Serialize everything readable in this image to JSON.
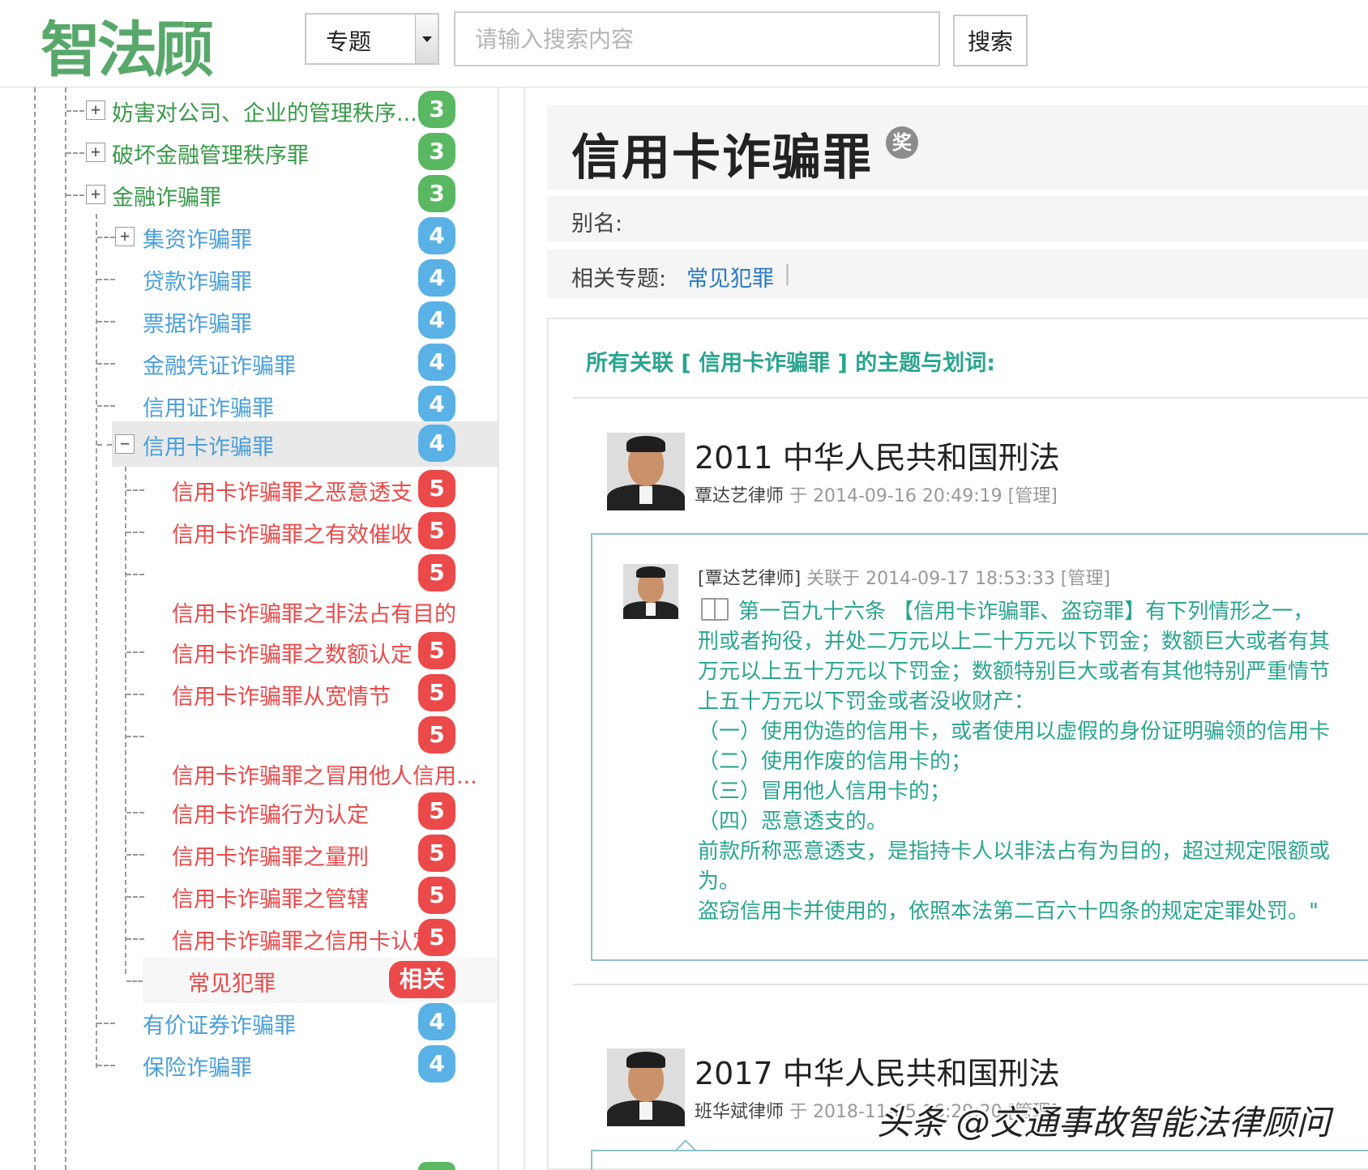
{
  "header": {
    "logo_text": "智法顾",
    "select_value": "专题",
    "search_placeholder": "请输入搜索内容",
    "search_button": "搜索"
  },
  "sidebar": {
    "items": [
      {
        "label": "妨害对公司、企业的管理秩序...",
        "badge": "3",
        "color": "green",
        "toggle": "+"
      },
      {
        "label": "破坏金融管理秩序罪",
        "badge": "3",
        "color": "green",
        "toggle": "+"
      },
      {
        "label": "金融诈骗罪",
        "badge": "3",
        "color": "green",
        "toggle": "+"
      },
      {
        "label": "集资诈骗罪",
        "badge": "4",
        "color": "blue",
        "toggle": "+"
      },
      {
        "label": "贷款诈骗罪",
        "badge": "4",
        "color": "blue"
      },
      {
        "label": "票据诈骗罪",
        "badge": "4",
        "color": "blue"
      },
      {
        "label": "金融凭证诈骗罪",
        "badge": "4",
        "color": "blue"
      },
      {
        "label": "信用证诈骗罪",
        "badge": "4",
        "color": "blue"
      },
      {
        "label": "信用卡诈骗罪",
        "badge": "4",
        "color": "blue",
        "toggle": "−"
      },
      {
        "label": "信用卡诈骗罪之恶意透支",
        "badge": "5",
        "color": "red"
      },
      {
        "label": "信用卡诈骗罪之有效催收",
        "badge": "5",
        "color": "red"
      },
      {
        "label": "",
        "badge": "5",
        "color": "red"
      },
      {
        "label": "信用卡诈骗罪之非法占有目的",
        "badge": "",
        "color": "red"
      },
      {
        "label": "信用卡诈骗罪之数额认定",
        "badge": "5",
        "color": "red"
      },
      {
        "label": "信用卡诈骗罪从宽情节",
        "badge": "5",
        "color": "red"
      },
      {
        "label": "",
        "badge": "5",
        "color": "red"
      },
      {
        "label": "信用卡诈骗罪之冒用他人信用...",
        "badge": "",
        "color": "red"
      },
      {
        "label": "信用卡诈骗行为认定",
        "badge": "5",
        "color": "red"
      },
      {
        "label": "信用卡诈骗罪之量刑",
        "badge": "5",
        "color": "red"
      },
      {
        "label": "信用卡诈骗罪之管辖",
        "badge": "5",
        "color": "red"
      },
      {
        "label": "信用卡诈骗罪之信用卡认定",
        "badge": "5",
        "color": "red"
      },
      {
        "label": "常见犯罪",
        "badge": "相关",
        "color": "red"
      },
      {
        "label": "有价证券诈骗罪",
        "badge": "4",
        "color": "blue"
      },
      {
        "label": "保险诈骗罪",
        "badge": "4",
        "color": "blue"
      }
    ]
  },
  "main": {
    "title": "信用卡诈骗罪",
    "award_icon_text": "奖",
    "alias_label": "别名:",
    "topic_label": "相关专题:",
    "topic_link": "常见犯罪",
    "topic_sep": "|",
    "section_heading": "所有关联 [ 信用卡诈骗罪 ] 的主题与划词:",
    "posts": [
      {
        "title": "2011 中华人民共和国刑法",
        "author": "覃达艺律师",
        "meta": " 于 2014-09-16 20:49:19    [管理]"
      },
      {
        "title": "2017 中华人民共和国刑法",
        "author": "班华斌律师",
        "meta": " 于 2018-11-05 16:29:20    [管理]"
      }
    ],
    "comment": {
      "author": "[覃达艺律师]",
      "meta": " 关联于  2014-09-17 18:53:33    [管理]",
      "lines": [
        "第一百九十六条    【信用卡诈骗罪、盗窃罪】有下列情形之一，",
        "刑或者拘役，并处二万元以上二十万元以下罚金；数额巨大或者有其",
        "万元以上五十万元以下罚金；数额特别巨大或者有其他特别严重情节",
        "上五十万元以下罚金或者没收财产：",
        "（一）使用伪造的信用卡，或者使用以虚假的身份证明骗领的信用卡",
        "（二）使用作废的信用卡的；",
        "（三）冒用他人信用卡的；",
        "（四）恶意透支的。",
        "前款所称恶意透支，是指持卡人以非法占有为目的，超过规定限额或",
        "为。",
        "盗窃信用卡并使用的，依照本法第二百六十四条的规定定罪处罚。\""
      ]
    }
  },
  "watermark": "头条 @交通事故智能法律顾问",
  "colors": {
    "brand_green": "#59a86b",
    "badge_green": "#59b861",
    "badge_blue": "#5ab1e6",
    "badge_red": "#ec4a4a",
    "teal_text": "#2ba58f",
    "link_blue": "#2a7bc4"
  }
}
